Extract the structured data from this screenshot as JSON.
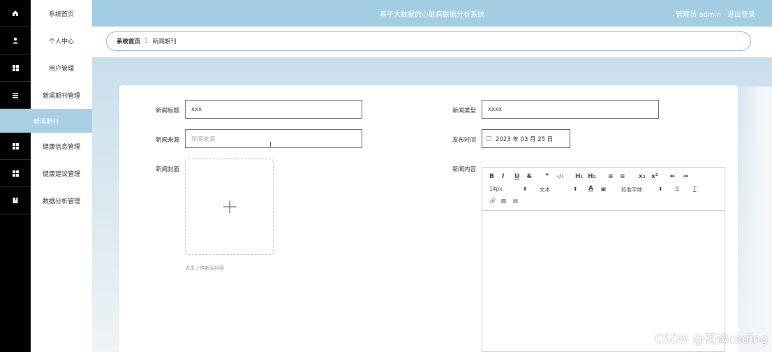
{
  "sidebar": {
    "items": [
      {
        "label": "系统首页",
        "icon": "home-icon"
      },
      {
        "label": "个人中心",
        "icon": "person-icon"
      },
      {
        "label": "用户管理",
        "icon": "grid-icon"
      },
      {
        "label": "新闻期刊管理",
        "icon": "list-icon"
      },
      {
        "label": "新闻期刊",
        "icon": "",
        "sub": true
      },
      {
        "label": "健康信息管理",
        "icon": "grid-icon"
      },
      {
        "label": "健康建议管理",
        "icon": "grid-icon"
      },
      {
        "label": "数据分析管理",
        "icon": "book-icon"
      }
    ]
  },
  "header": {
    "title": "基于大数据的心脏病数据分析系统",
    "user": "管理员 admin",
    "logout": "退出登录"
  },
  "breadcrumb": {
    "home": "系统首页",
    "sep": "Ξ",
    "current": "新闻期刊"
  },
  "form": {
    "title_label": "新闻标题",
    "title_value": "xxx",
    "type_label": "新闻类型",
    "type_value": "xxxx",
    "source_label": "新闻来源",
    "source_placeholder": "新闻来源",
    "date_label": "发布时间",
    "date_value": "2023 年 03 月 25 日",
    "cover_label": "新闻封面",
    "cover_hint": "点击上传新闻封面",
    "content_label": "新闻内容"
  },
  "editor": {
    "row1": [
      "B",
      "I",
      "U",
      "S",
      "❞",
      "‹/›",
      "H₁",
      "H₂",
      "≡",
      "≡",
      "x₂",
      "x²",
      "⇤",
      "⇥"
    ],
    "font_size": "14px",
    "text_style": "文本",
    "font_family": "标准字体"
  },
  "watermark": "CSDN @花椒coding"
}
